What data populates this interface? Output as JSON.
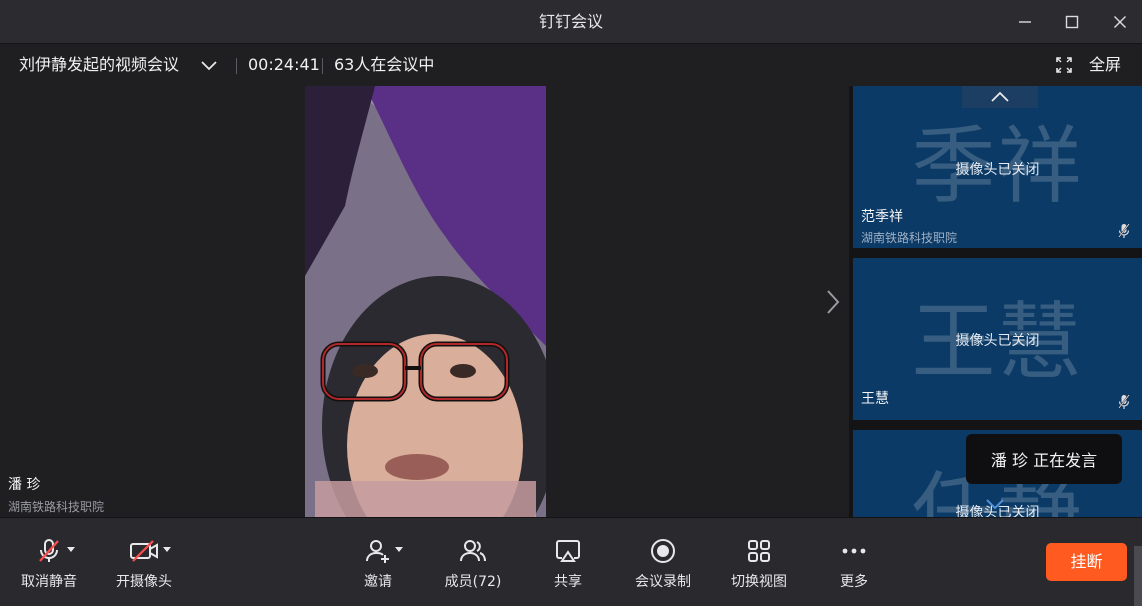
{
  "window": {
    "title": "钉钉会议",
    "minimize_icon": "minimize-icon",
    "maximize_icon": "maximize-icon",
    "close_icon": "close-icon"
  },
  "infobar": {
    "meeting_name": "刘伊静发起的视频会议",
    "timer": "00:24:41",
    "participants_in_meeting": "63人在会议中",
    "fullscreen_label": "全屏"
  },
  "main_speaker": {
    "name": "潘 珍",
    "org": "湖南铁路科技职院"
  },
  "tiles": [
    {
      "avatar_text": "季祥",
      "camera_status": "摄像头已关闭",
      "name": "范季祥",
      "org": "湖南铁路科技职院",
      "muted": true
    },
    {
      "avatar_text": "王慧",
      "camera_status": "摄像头已关闭",
      "name": "王慧",
      "org": "",
      "muted": true
    },
    {
      "avatar_text": "任静",
      "camera_status": "摄像头已关闭",
      "name": "",
      "org": "",
      "muted": false
    }
  ],
  "speaking_indicator": "潘 珍  正在发言",
  "toolbar": {
    "unmute": "取消静音",
    "camera_on": "开摄像头",
    "invite": "邀请",
    "members": "成员(72)",
    "share": "共享",
    "record": "会议录制",
    "switch_view": "切换视图",
    "more": "更多",
    "hangup": "挂断"
  },
  "colors": {
    "hangup": "#ff5a1f",
    "tile_bg": "#0b3a66",
    "mute_slash": "#ff4d4f"
  }
}
